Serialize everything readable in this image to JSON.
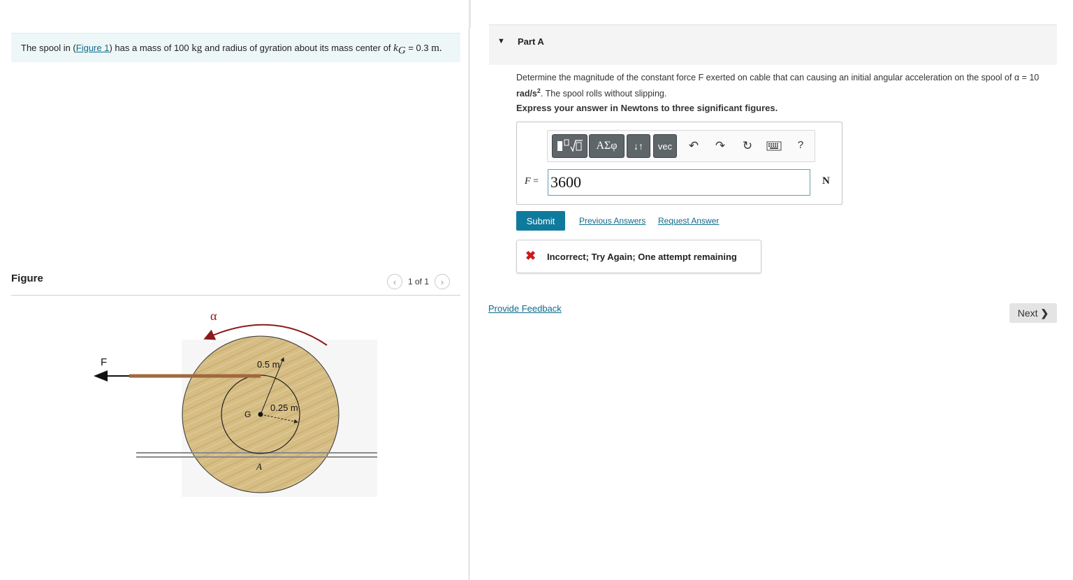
{
  "problem": {
    "prefix": "The spool in (",
    "figure_link": "Figure 1",
    "middle": ") has a mass of 100",
    "mass_unit": "kg",
    "middle2": "and radius of gyration about its mass center of",
    "k_symbol": "k",
    "k_sub": "G",
    "equals": "= 0.3",
    "radius_unit": "m."
  },
  "figure": {
    "label": "Figure",
    "pager_text": "1 of 1",
    "prev_icon": "chevron-left-icon",
    "next_icon": "chevron-right-icon",
    "alpha_label": "α",
    "force_label": "F",
    "outer_radius_label": "0.5 m",
    "inner_radius_label": "0.25 m",
    "center_label": "G",
    "contact_label": "A",
    "colors": {
      "wood": "#d6bd84",
      "arrow": "#8b1a1a"
    }
  },
  "part": {
    "title": "Part A",
    "question_pre": "Determine the magnitude of the constant force F exerted on cable that can causing an initial angular acceleration on the spool of α =",
    "question_value": "10",
    "question_unit": "rad/s",
    "question_exp": "2",
    "question_post": ". The spool rolls without slipping.",
    "instruction": "Express your answer in Newtons to three significant figures."
  },
  "toolbar": {
    "templates_icon": "templates-icon",
    "greek_label": "ΑΣφ",
    "updown_label": "↓↑",
    "vec_label": "vec",
    "undo_icon": "undo-icon",
    "redo_icon": "redo-icon",
    "reset_icon": "reset-icon",
    "keyboard_icon": "keyboard-icon",
    "help_label": "?"
  },
  "answer": {
    "variable": "F",
    "equals": "=",
    "value": "3600",
    "unit": "N"
  },
  "actions": {
    "submit": "Submit",
    "previous_answers": "Previous Answers",
    "request_answer": "Request Answer"
  },
  "feedback": {
    "icon": "x-icon",
    "text": "Incorrect; Try Again; One attempt remaining",
    "color": "#d01919"
  },
  "footer": {
    "provide_feedback": "Provide Feedback",
    "next": "Next",
    "next_icon": "chevron-right-icon"
  },
  "colors": {
    "accent": "#0f7a9c",
    "link": "#0f6a8b",
    "problem_bg": "#eef7f8",
    "toolbar_button": "#5e6669"
  }
}
